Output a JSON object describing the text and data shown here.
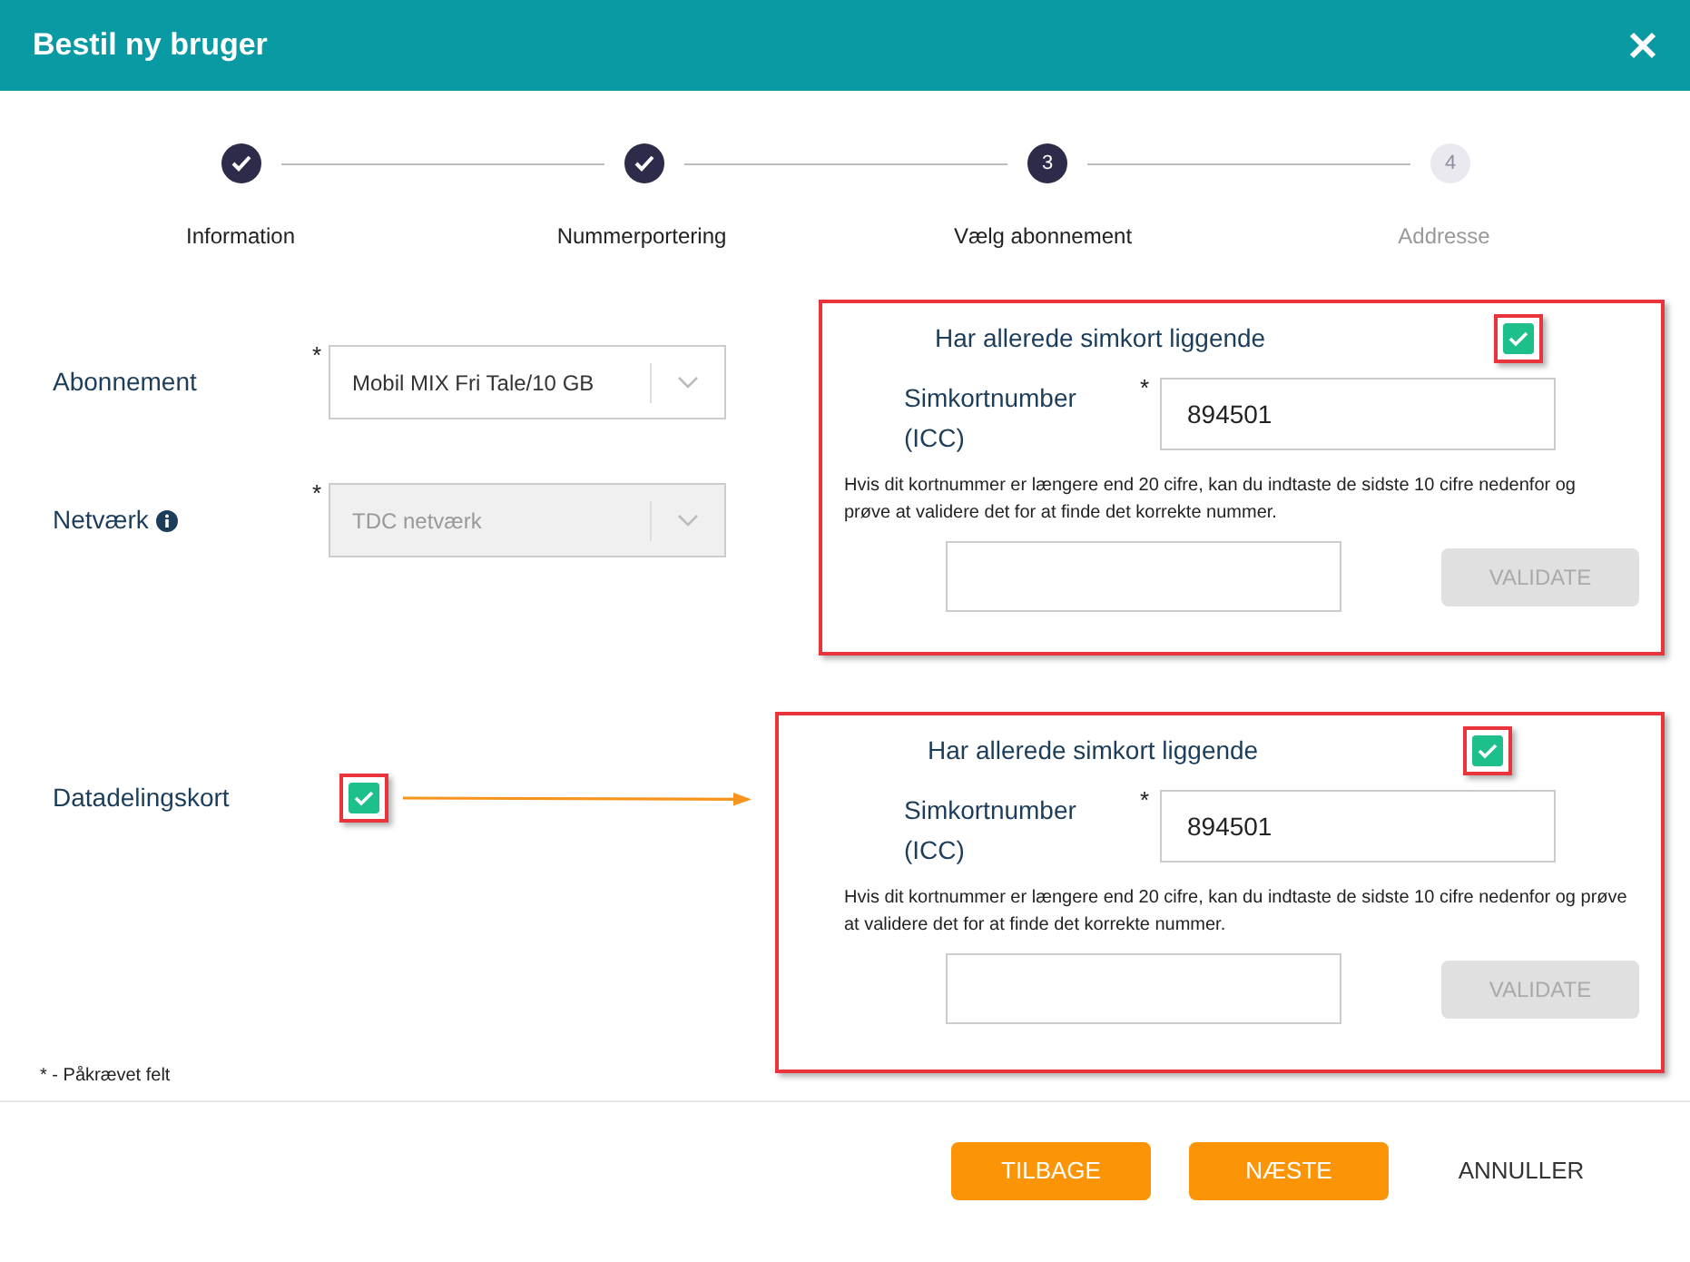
{
  "dialog": {
    "title": "Bestil ny bruger"
  },
  "steps": [
    {
      "label": "Information",
      "completed": true,
      "active": false
    },
    {
      "label": "Nummerportering",
      "completed": true,
      "active": false
    },
    {
      "label": "Vælg abonnement",
      "completed": false,
      "active": true,
      "number": "3"
    },
    {
      "label": "Addresse",
      "completed": false,
      "active": false,
      "number": "4"
    }
  ],
  "fields": [
    {
      "label": "Abonnement",
      "required_mark": "*",
      "value": "Mobil MIX Fri Tale/10 GB",
      "disabled": false,
      "info": false
    },
    {
      "label": "Netværk",
      "required_mark": "*",
      "value": "TDC netværk",
      "disabled": true,
      "info": true
    }
  ],
  "data_sharing": {
    "label": "Datadelingskort",
    "checked": true
  },
  "sim_panels": [
    {
      "title": "Har allerede simkort liggende",
      "checked": true,
      "field_label": "Simkortnumber (ICC)",
      "required_mark": "*",
      "value": "894501",
      "help": "Hvis dit kortnummer er længere end 20 cifre, kan du indtaste de sidste 10 cifre nedenfor og prøve at validere det for at finde det korrekte nummer.",
      "validate_button": "VALIDATE",
      "validate_disabled": true
    },
    {
      "title": "Har allerede simkort liggende",
      "checked": true,
      "field_label": "Simkortnumber (ICC)",
      "required_mark": "*",
      "value": "894501",
      "help": "Hvis dit kortnummer er længere end 20 cifre, kan du indtaste de sidste 10 cifre nedenfor og prøve at validere det for at finde det korrekte nummer.",
      "validate_button": "VALIDATE",
      "validate_disabled": true
    }
  ],
  "required_note": "* - Påkrævet felt",
  "buttons": [
    {
      "label": "TILBAGE",
      "kind": "primary"
    },
    {
      "label": "NÆSTE",
      "kind": "primary"
    },
    {
      "label": "ANNULLER",
      "kind": "link"
    }
  ]
}
